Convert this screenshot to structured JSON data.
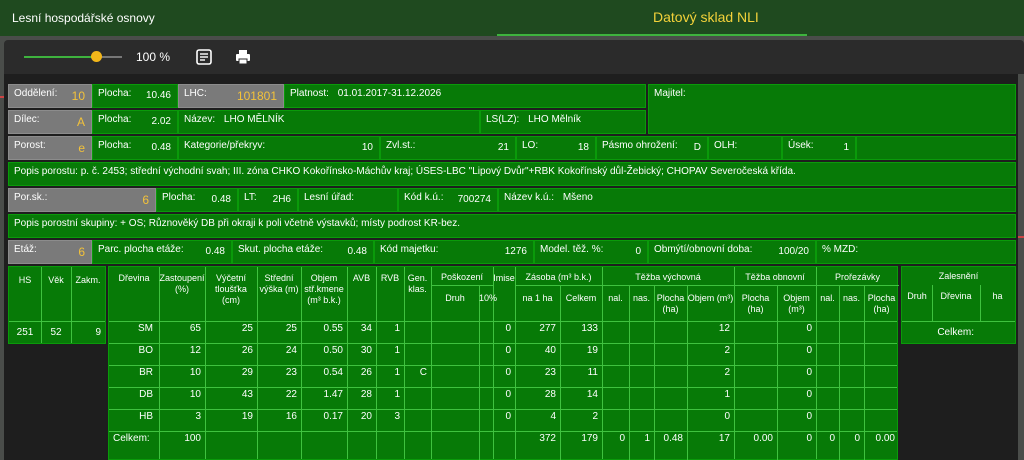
{
  "header": {
    "title": "Lesní hospodářské osnovy",
    "sklad": "Datový sklad NLI"
  },
  "toolbar": {
    "zoom": "100 %",
    "zoom_fraction": 0.7,
    "icons": [
      "notes-icon",
      "print-icon"
    ]
  },
  "info": {
    "oddeleni_lbl": "Oddělení:",
    "oddeleni": "10",
    "plocha1_lbl": "Plocha:",
    "plocha1": "10.46",
    "lhc_lbl": "LHC:",
    "lhc": "101801",
    "platnost_lbl": "Platnost:",
    "platnost": "01.01.2017-31.12.2026",
    "majitel_lbl": "Majitel:",
    "dilec_lbl": "Dílec:",
    "dilec": "A",
    "plocha2_lbl": "Plocha:",
    "plocha2": "2.02",
    "nazev_lbl": "Název:",
    "nazev": "LHO MĚLNÍK",
    "ls_lbl": "LS(LZ):",
    "ls": "LHO Mělník",
    "porost_lbl": "Porost:",
    "porost": "e",
    "plocha3_lbl": "Plocha:",
    "plocha3": "0.48",
    "kat_lbl": "Kategorie/překryv:",
    "kat": "10",
    "zvl_lbl": "Zvl.st.:",
    "zvl": "21",
    "lo_lbl": "LO:",
    "lo": "18",
    "pasmo_lbl": "Pásmo ohrožení:",
    "pasmo": "D",
    "olh_lbl": "OLH:",
    "usek_lbl": "Úsek:",
    "usek": "1",
    "popis_porostu_lbl": "Popis porostu:",
    "popis_porostu": "p. č. 2453; střední východní svah; III. zóna CHKO Kokořínsko-Máchův kraj; ÚSES-LBC \"Lipový Dvůr\"+RBK Kokořínský důl-Žebický; CHOPAV Severočeská křída.",
    "porsk_lbl": "Por.sk.:",
    "porsk": "6",
    "plocha4_lbl": "Plocha:",
    "plocha4": "0.48",
    "lt_lbl": "LT:",
    "lt": "2H6",
    "lesni_urad_lbl": "Lesní úřad:",
    "kodku_lbl": "Kód k.ú.:",
    "kodku": "700274",
    "nazku_lbl": "Název k.ú.:",
    "nazku": "Mšeno",
    "popis_skup_lbl": "Popis porostní skupiny:",
    "popis_skup": "+ OS; Různověký DB při okraji k poli včetně výstavků; místy podrost KR-bez.",
    "etaz_lbl": "Etáž:",
    "etaz": "6",
    "parc_lbl": "Parc. plocha etáže:",
    "parc": "0.48",
    "skut_lbl": "Skut. plocha etáže:",
    "skut": "0.48",
    "kodmaj_lbl": "Kód majetku:",
    "kodmaj": "1276",
    "model_lbl": "Model. těž. %:",
    "model": "0",
    "obmyti_lbl": "Obmýtí/obnovní doba:",
    "obmyti": "100/20",
    "mzd_lbl": "% MZD:"
  },
  "hs_table": {
    "headers": [
      "HS",
      "Věk",
      "Zakm."
    ],
    "values": [
      "251",
      "52",
      "9"
    ]
  },
  "main_table": {
    "h_drevina": "Dřevina",
    "h_zast": "Zastoupení (%)",
    "h_vyc": "Výčetní tloušťka (cm)",
    "h_str": "Střední výška (m)",
    "h_obj": "Objem stř.kmene (m³ b.k.)",
    "h_avb": "AVB",
    "h_rvb": "RVB",
    "h_gen": "Gen. klas.",
    "h_posk": "Poškození",
    "h_druh": "Druh",
    "h_10": "10%",
    "h_imise": "Imise",
    "h_zasoba": "Zásoba (m³ b.k.)",
    "h_na1ha": "na 1 ha",
    "h_celkem": "Celkem",
    "h_tv": "Těžba výchovná",
    "h_to": "Těžba obnovní",
    "h_proc": "Prořezávky",
    "h_nal": "nal.",
    "h_nas": "nas.",
    "h_plocha": "Plocha (ha)",
    "h_objem": "Objem (m³)",
    "rows": [
      [
        "SM",
        "65",
        "25",
        "25",
        "0.55",
        "34",
        "1",
        "",
        "",
        "",
        "0",
        "277",
        "133",
        "",
        "",
        "",
        "12",
        "",
        "0",
        "",
        "",
        ""
      ],
      [
        "BO",
        "12",
        "26",
        "24",
        "0.50",
        "30",
        "1",
        "",
        "",
        "",
        "0",
        "40",
        "19",
        "",
        "",
        "",
        "2",
        "",
        "0",
        "",
        "",
        ""
      ],
      [
        "BR",
        "10",
        "29",
        "23",
        "0.54",
        "26",
        "1",
        "C",
        "",
        "",
        "0",
        "23",
        "11",
        "",
        "",
        "",
        "2",
        "",
        "0",
        "",
        "",
        ""
      ],
      [
        "DB",
        "10",
        "43",
        "22",
        "1.47",
        "28",
        "1",
        "",
        "",
        "",
        "0",
        "28",
        "14",
        "",
        "",
        "",
        "1",
        "",
        "0",
        "",
        "",
        ""
      ],
      [
        "HB",
        "3",
        "19",
        "16",
        "0.17",
        "20",
        "3",
        "",
        "",
        "",
        "0",
        "4",
        "2",
        "",
        "",
        "",
        "0",
        "",
        "0",
        "",
        "",
        ""
      ]
    ],
    "total": [
      "Celkem:",
      "100",
      "",
      "",
      "",
      "",
      "",
      "",
      "",
      "",
      "",
      "372",
      "179",
      "0",
      "1",
      "0.48",
      "17",
      "0.00",
      "0",
      "0",
      "0",
      "0.00"
    ]
  },
  "zales": {
    "title": "Zalesnění",
    "h_druh": "Druh",
    "h_drevina": "Dřevina",
    "h_ha": "ha",
    "celkem": "Celkem:"
  }
}
